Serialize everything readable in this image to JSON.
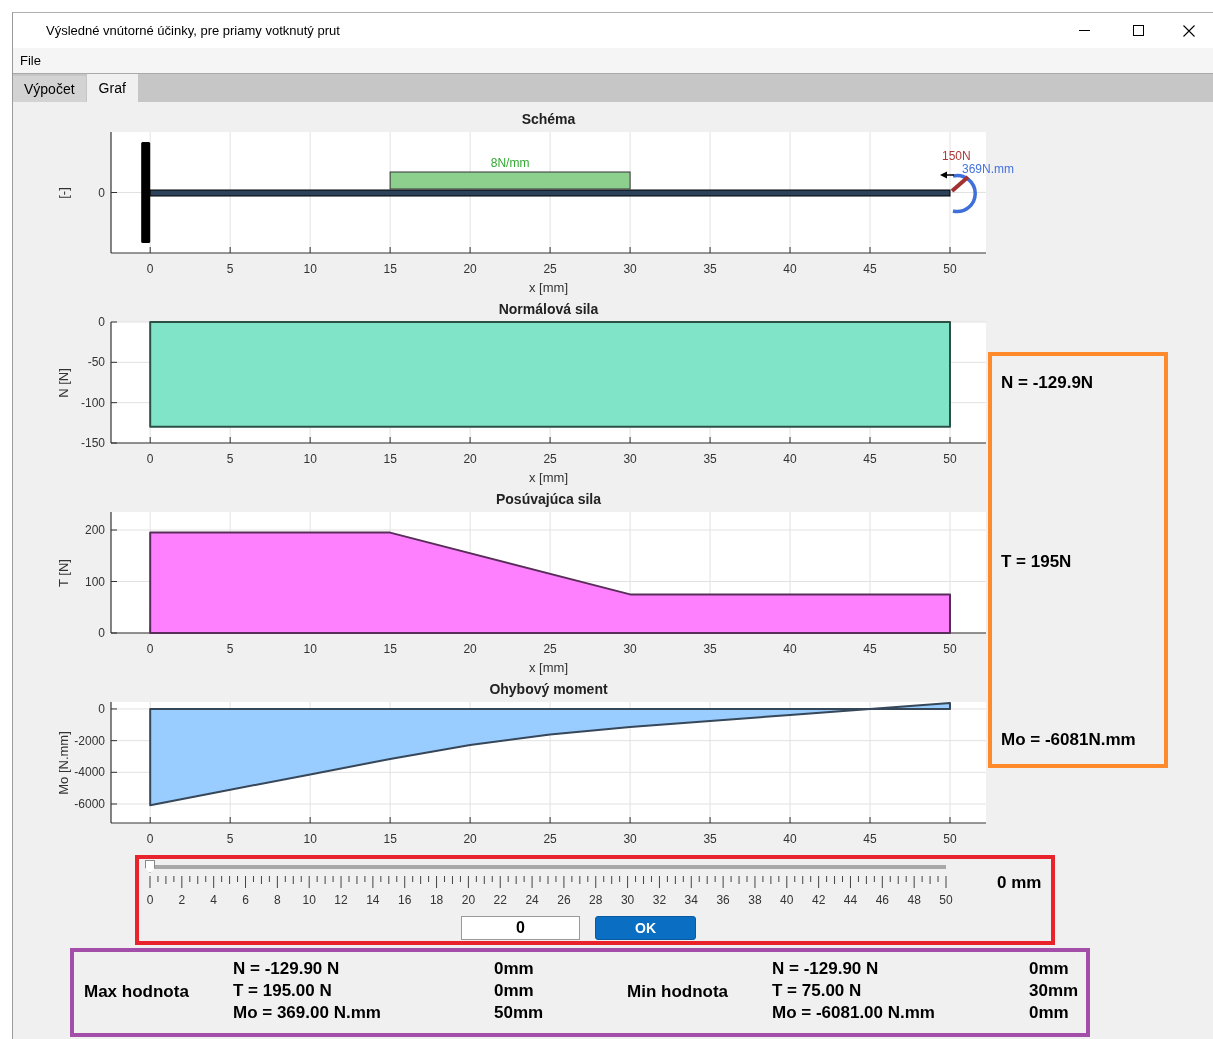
{
  "window": {
    "title": "Výsledné vnútorné účinky, pre priamy votknutý prut"
  },
  "menu": [
    "File"
  ],
  "tabs": [
    {
      "label": "Výpočet",
      "selected": false
    },
    {
      "label": "Graf",
      "selected": true
    }
  ],
  "schema": {
    "title": "Schéma",
    "ylabel": "[-]",
    "yticks": [
      "0"
    ],
    "xticks": [
      "0",
      "5",
      "10",
      "15",
      "20",
      "25",
      "30",
      "35",
      "40",
      "45",
      "50"
    ],
    "xlabel": "x [mm]",
    "load_label": "8N/mm",
    "force_label": "150N",
    "moment_label": "369N.mm"
  },
  "charts": [
    {
      "chart_data": {
        "type": "area",
        "title": "Normálová sila",
        "xlabel": "x [mm]",
        "ylabel": "N [N]",
        "x": [
          0,
          50
        ],
        "grid": true,
        "series": [
          {
            "color": "#80e4c8",
            "values": [
              -129.9,
              -129.9
            ]
          }
        ],
        "xlim": [
          -2.45,
          52.25
        ],
        "ylim": [
          -150,
          0
        ],
        "xticks": [
          0,
          5,
          10,
          15,
          20,
          25,
          30,
          35,
          40,
          45,
          50
        ],
        "yticks": [
          -150,
          -100,
          -50,
          0
        ]
      }
    },
    {
      "chart_data": {
        "type": "area",
        "title": "Posúvajúca sila",
        "xlabel": "x [mm]",
        "ylabel": "T [N]",
        "x": [
          0,
          15,
          30,
          50
        ],
        "grid": true,
        "series": [
          {
            "color": "#ff80ff",
            "values": [
              195,
              195,
              75,
              75
            ]
          }
        ],
        "xlim": [
          -2.45,
          52.25
        ],
        "ylim": [
          0,
          235
        ],
        "xticks": [
          0,
          5,
          10,
          15,
          20,
          25,
          30,
          35,
          40,
          45,
          50
        ],
        "yticks": [
          0,
          100,
          200
        ]
      }
    },
    {
      "chart_data": {
        "type": "area",
        "title": "Ohybový moment",
        "ylabel": "Mo [N.mm]",
        "x": [
          0,
          5,
          10,
          15,
          20,
          25,
          30,
          35,
          40,
          45,
          50
        ],
        "grid": true,
        "series": [
          {
            "color": "#99ccff",
            "values": [
              -6081,
              -5106,
              -4131,
              -3156,
              -2281,
              -1606,
              -1131,
              -756,
              -381,
              -6,
              369
            ]
          }
        ],
        "xlim": [
          -2.45,
          52.25
        ],
        "ylim": [
          -7200,
          440
        ],
        "xticks": [
          0,
          5,
          10,
          15,
          20,
          25,
          30,
          35,
          40,
          45,
          50
        ],
        "yticks": [
          -6000,
          -4000,
          -2000,
          0
        ]
      }
    }
  ],
  "readouts": [
    "N = -129.9N",
    "T = 195N",
    "Mo = -6081N.mm"
  ],
  "slider": {
    "level": 0,
    "scale": [
      "0",
      "2",
      "4",
      "6",
      "8",
      "10",
      "12",
      "14",
      "16",
      "18",
      "20",
      "22",
      "24",
      "26",
      "28",
      "30",
      "32",
      "34",
      "36",
      "38",
      "40",
      "42",
      "44",
      "46",
      "48",
      "50"
    ],
    "readout": "0 mm"
  },
  "position_input": {
    "value": "0"
  },
  "ok_button": "OK",
  "summary": [
    {
      "label": "Max hodnota",
      "rows": [
        {
          "value": "N = -129.90 N",
          "at": "0mm"
        },
        {
          "value": "T = 195.00 N",
          "at": "0mm"
        },
        {
          "value": "Mo = 369.00 N.mm",
          "at": "50mm"
        }
      ]
    },
    {
      "label": "Min hodnota",
      "rows": [
        {
          "value": "N = -129.90 N",
          "at": "0mm"
        },
        {
          "value": "T = 75.00 N",
          "at": "30mm"
        },
        {
          "value": "Mo = -6081.00 N.mm",
          "at": "0mm"
        }
      ]
    }
  ]
}
